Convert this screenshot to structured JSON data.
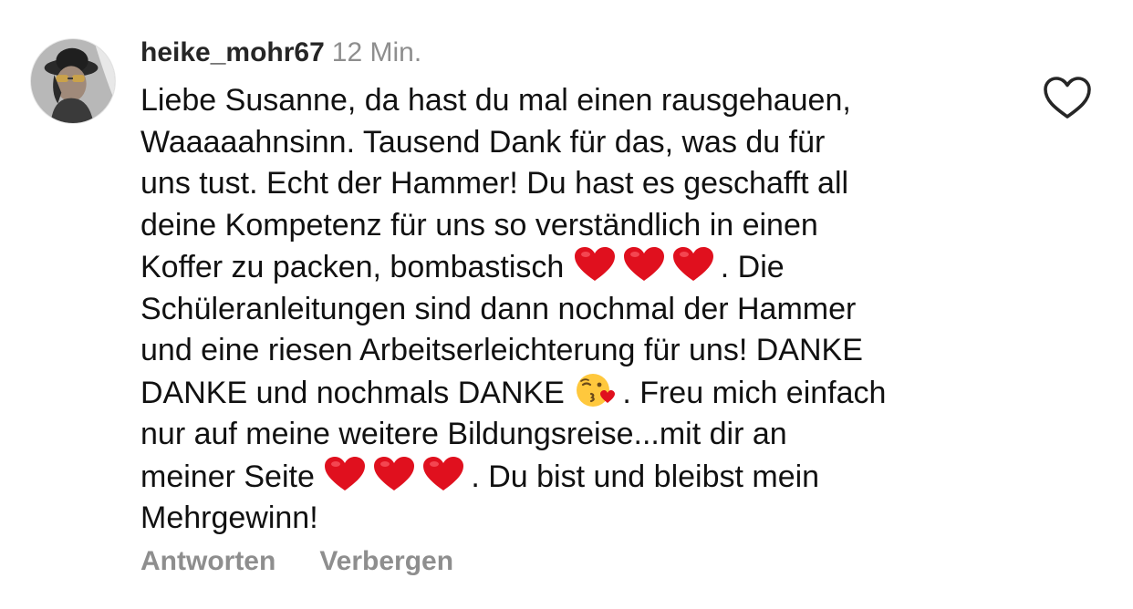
{
  "comment": {
    "username": "heike_mohr67",
    "timestamp": "12 Min.",
    "avatar_icon": "user-avatar-sunglasses-hat",
    "lines": [
      "Liebe Susanne, da hast du mal einen rausgehauen,",
      "Waaaaahnsinn. Tausend Dank für das, was du für",
      "uns tust. Echt der Hammer! Du hast es geschafft all",
      "deine Kompetenz für uns so verständlich in einen"
    ],
    "line5_before": "Koffer zu packen, bombastisch",
    "line5_after": ". Die",
    "line6": "Schüleranleitungen sind dann nochmal der Hammer",
    "line7": "und eine riesen Arbeitserleichterung für uns! DANKE",
    "line8_before": "DANKE und nochmals DANKE",
    "line8_after": ". Freu mich einfach",
    "line9": "nur auf meine weitere Bildungsreise...mit dir an",
    "line10_before": "meiner Seite",
    "line10_after": ". Du bist und bleibst mein",
    "line11": "Mehrgewinn!",
    "emoji_heart": "red-heart-emoji",
    "emoji_kiss": "face-blowing-kiss-emoji"
  },
  "actions": {
    "reply_label": "Antworten",
    "hide_label": "Verbergen"
  },
  "like_icon": "heart-outline-icon",
  "colors": {
    "text": "#111111",
    "username": "#262626",
    "secondary": "#8e8e8e",
    "heart_emoji": "#e0101e",
    "kiss_face": "#ffc83d",
    "like_outline": "#262626"
  }
}
